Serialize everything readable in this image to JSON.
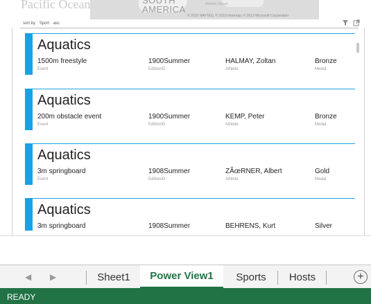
{
  "map": {
    "continent_label": "SOUTH\nAMERICA",
    "ocean_label": "Atlantic Ocean",
    "copyright": "© 2010 NAVTEQ, © 2010 Intermap, © 2013 Microsoft Corporation",
    "faded_left": "Pacific Ocean",
    "faded_left2": ""
  },
  "sort": {
    "prefix": "sort by",
    "field": "Sport",
    "order": "asc"
  },
  "cards": [
    {
      "sport": "Aquatics",
      "event": "1500m freestyle",
      "edition": "1900Summer",
      "athlete": "HALMAY, Zoltan",
      "medal": "Bronze"
    },
    {
      "sport": "Aquatics",
      "event": "200m obstacle event",
      "edition": "1900Summer",
      "athlete": "KEMP, Peter",
      "medal": "Bronze"
    },
    {
      "sport": "Aquatics",
      "event": "3m springboard",
      "edition": "1908Summer",
      "athlete": "ZÃœRNER, Albert",
      "medal": "Gold"
    },
    {
      "sport": "Aquatics",
      "event": "3m springboard",
      "edition": "1908Summer",
      "athlete": "BEHRENS, Kurt",
      "medal": "Silver"
    }
  ],
  "field_labels": {
    "event": "Event",
    "edition": "EditionID",
    "athlete": "Athlete",
    "medal": "Medal"
  },
  "sheet_tabs": [
    {
      "label": "Sheet1",
      "active": false
    },
    {
      "label": "Power View1",
      "active": true
    },
    {
      "label": "Sports",
      "active": false
    },
    {
      "label": "Hosts",
      "active": false
    }
  ],
  "status": {
    "text": "READY"
  },
  "colors": {
    "accent": "#1ba1e2",
    "excel_green": "#217346"
  },
  "icons": {
    "prev": "left-arrow-icon",
    "next": "right-arrow-icon",
    "add": "plus-circle-icon",
    "filter": "filter-icon",
    "popout": "pop-out-icon"
  }
}
